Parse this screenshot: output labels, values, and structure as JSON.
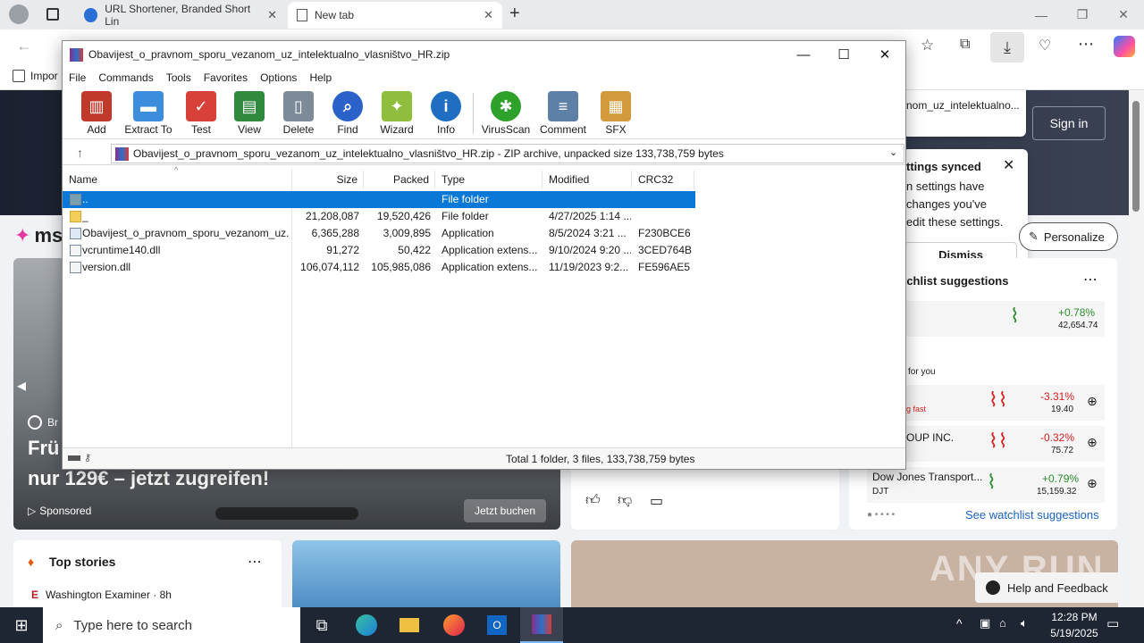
{
  "browser": {
    "tabs": [
      {
        "label": "URL Shortener, Branded Short Lin"
      },
      {
        "label": "New tab"
      }
    ],
    "favorites": {
      "label": "Impor"
    },
    "download_item": "nom_uz_intelektualno...",
    "sign_in": "Sign in",
    "settings_popup": {
      "title": "ttings synced",
      "line1": "n settings have",
      "line2": "changes you've",
      "line3": "edit these settings.",
      "dismiss": "Dismiss"
    },
    "personalize": "Personalize",
    "brand": "ms",
    "ad": {
      "brand_short": "Br",
      "line1": "Frü",
      "line2": "nur 129€ – jetzt zugreifen!",
      "sponsored": "Sponsored",
      "cta": "Jetzt buchen"
    },
    "watchlist": {
      "title": "tchlist suggestions",
      "items": [
        {
          "change": "+0.78%",
          "value": "42,654.74",
          "color": "#2c8c2c"
        },
        {
          "name": "g fast",
          "change": "-3.31%",
          "value": "19.40",
          "color": "#d42020"
        },
        {
          "name": "OUP INC.",
          "change": "-0.32%",
          "value": "75.72",
          "color": "#d42020"
        },
        {
          "name": "Dow Jones Transport...",
          "ticker": "DJT",
          "change": "+0.79%",
          "value": "15,159.32",
          "color": "#2c8c2c"
        }
      ],
      "for_you": "for you",
      "see_more": "See watchlist suggestions"
    },
    "top_stories": {
      "title": "Top stories",
      "source": "Washington Examiner · 8h"
    },
    "help": "Help and Feedback",
    "watermark": "ANY RUN"
  },
  "winrar": {
    "title": "Obavijest_o_pravnom_sporu_vezanom_uz_intelektualno_vlasništvo_HR.zip",
    "menu": [
      "File",
      "Commands",
      "Tools",
      "Favorites",
      "Options",
      "Help"
    ],
    "toolbar": [
      {
        "label": "Add",
        "icon": "books-icon",
        "color": "#c0392b"
      },
      {
        "label": "Extract To",
        "icon": "folder-icon",
        "color": "#3c8ddb"
      },
      {
        "label": "Test",
        "icon": "checklist-icon",
        "color": "#d8403a"
      },
      {
        "label": "View",
        "icon": "book-icon",
        "color": "#2f8a3e"
      },
      {
        "label": "Delete",
        "icon": "trash-icon",
        "color": "#7d8a99"
      },
      {
        "label": "Find",
        "icon": "magnifier-icon",
        "color": "#2b62c9"
      },
      {
        "label": "Wizard",
        "icon": "wand-icon",
        "color": "#8fbe3c"
      },
      {
        "label": "Info",
        "icon": "info-icon",
        "color": "#1f6ec2"
      },
      {
        "label": "VirusScan",
        "icon": "bug-icon",
        "color": "#2ea12a"
      },
      {
        "label": "Comment",
        "icon": "comment-icon",
        "color": "#5e7fa6"
      },
      {
        "label": "SFX",
        "icon": "box-icon",
        "color": "#d29a3a"
      }
    ],
    "path": "Obavijest_o_pravnom_sporu_vezanom_uz_intelektualno_vlasništvo_HR.zip - ZIP archive, unpacked size 133,738,759 bytes",
    "columns": [
      "Name",
      "Size",
      "Packed",
      "Type",
      "Modified",
      "CRC32"
    ],
    "rows": [
      {
        "name": "..",
        "size": "",
        "packed": "",
        "type": "File folder",
        "modified": "",
        "crc": ""
      },
      {
        "name": "_",
        "size": "21,208,087",
        "packed": "19,520,426",
        "type": "File folder",
        "modified": "4/27/2025 1:14 ...",
        "crc": ""
      },
      {
        "name": "Obavijest_o_pravnom_sporu_vezanom_uz...",
        "size": "6,365,288",
        "packed": "3,009,895",
        "type": "Application",
        "modified": "8/5/2024 3:21 ...",
        "crc": "F230BCE6"
      },
      {
        "name": "vcruntime140.dll",
        "size": "91,272",
        "packed": "50,422",
        "type": "Application extens...",
        "modified": "9/10/2024 9:20 ...",
        "crc": "3CED764B"
      },
      {
        "name": "version.dll",
        "size": "106,074,112",
        "packed": "105,985,086",
        "type": "Application extens...",
        "modified": "11/19/2023 9:2...",
        "crc": "FE596AE5"
      }
    ],
    "status": "Total 1 folder, 3 files, 133,738,759 bytes"
  },
  "taskbar": {
    "search_placeholder": "Type here to search",
    "time": "12:28 PM",
    "date": "5/19/2025"
  }
}
